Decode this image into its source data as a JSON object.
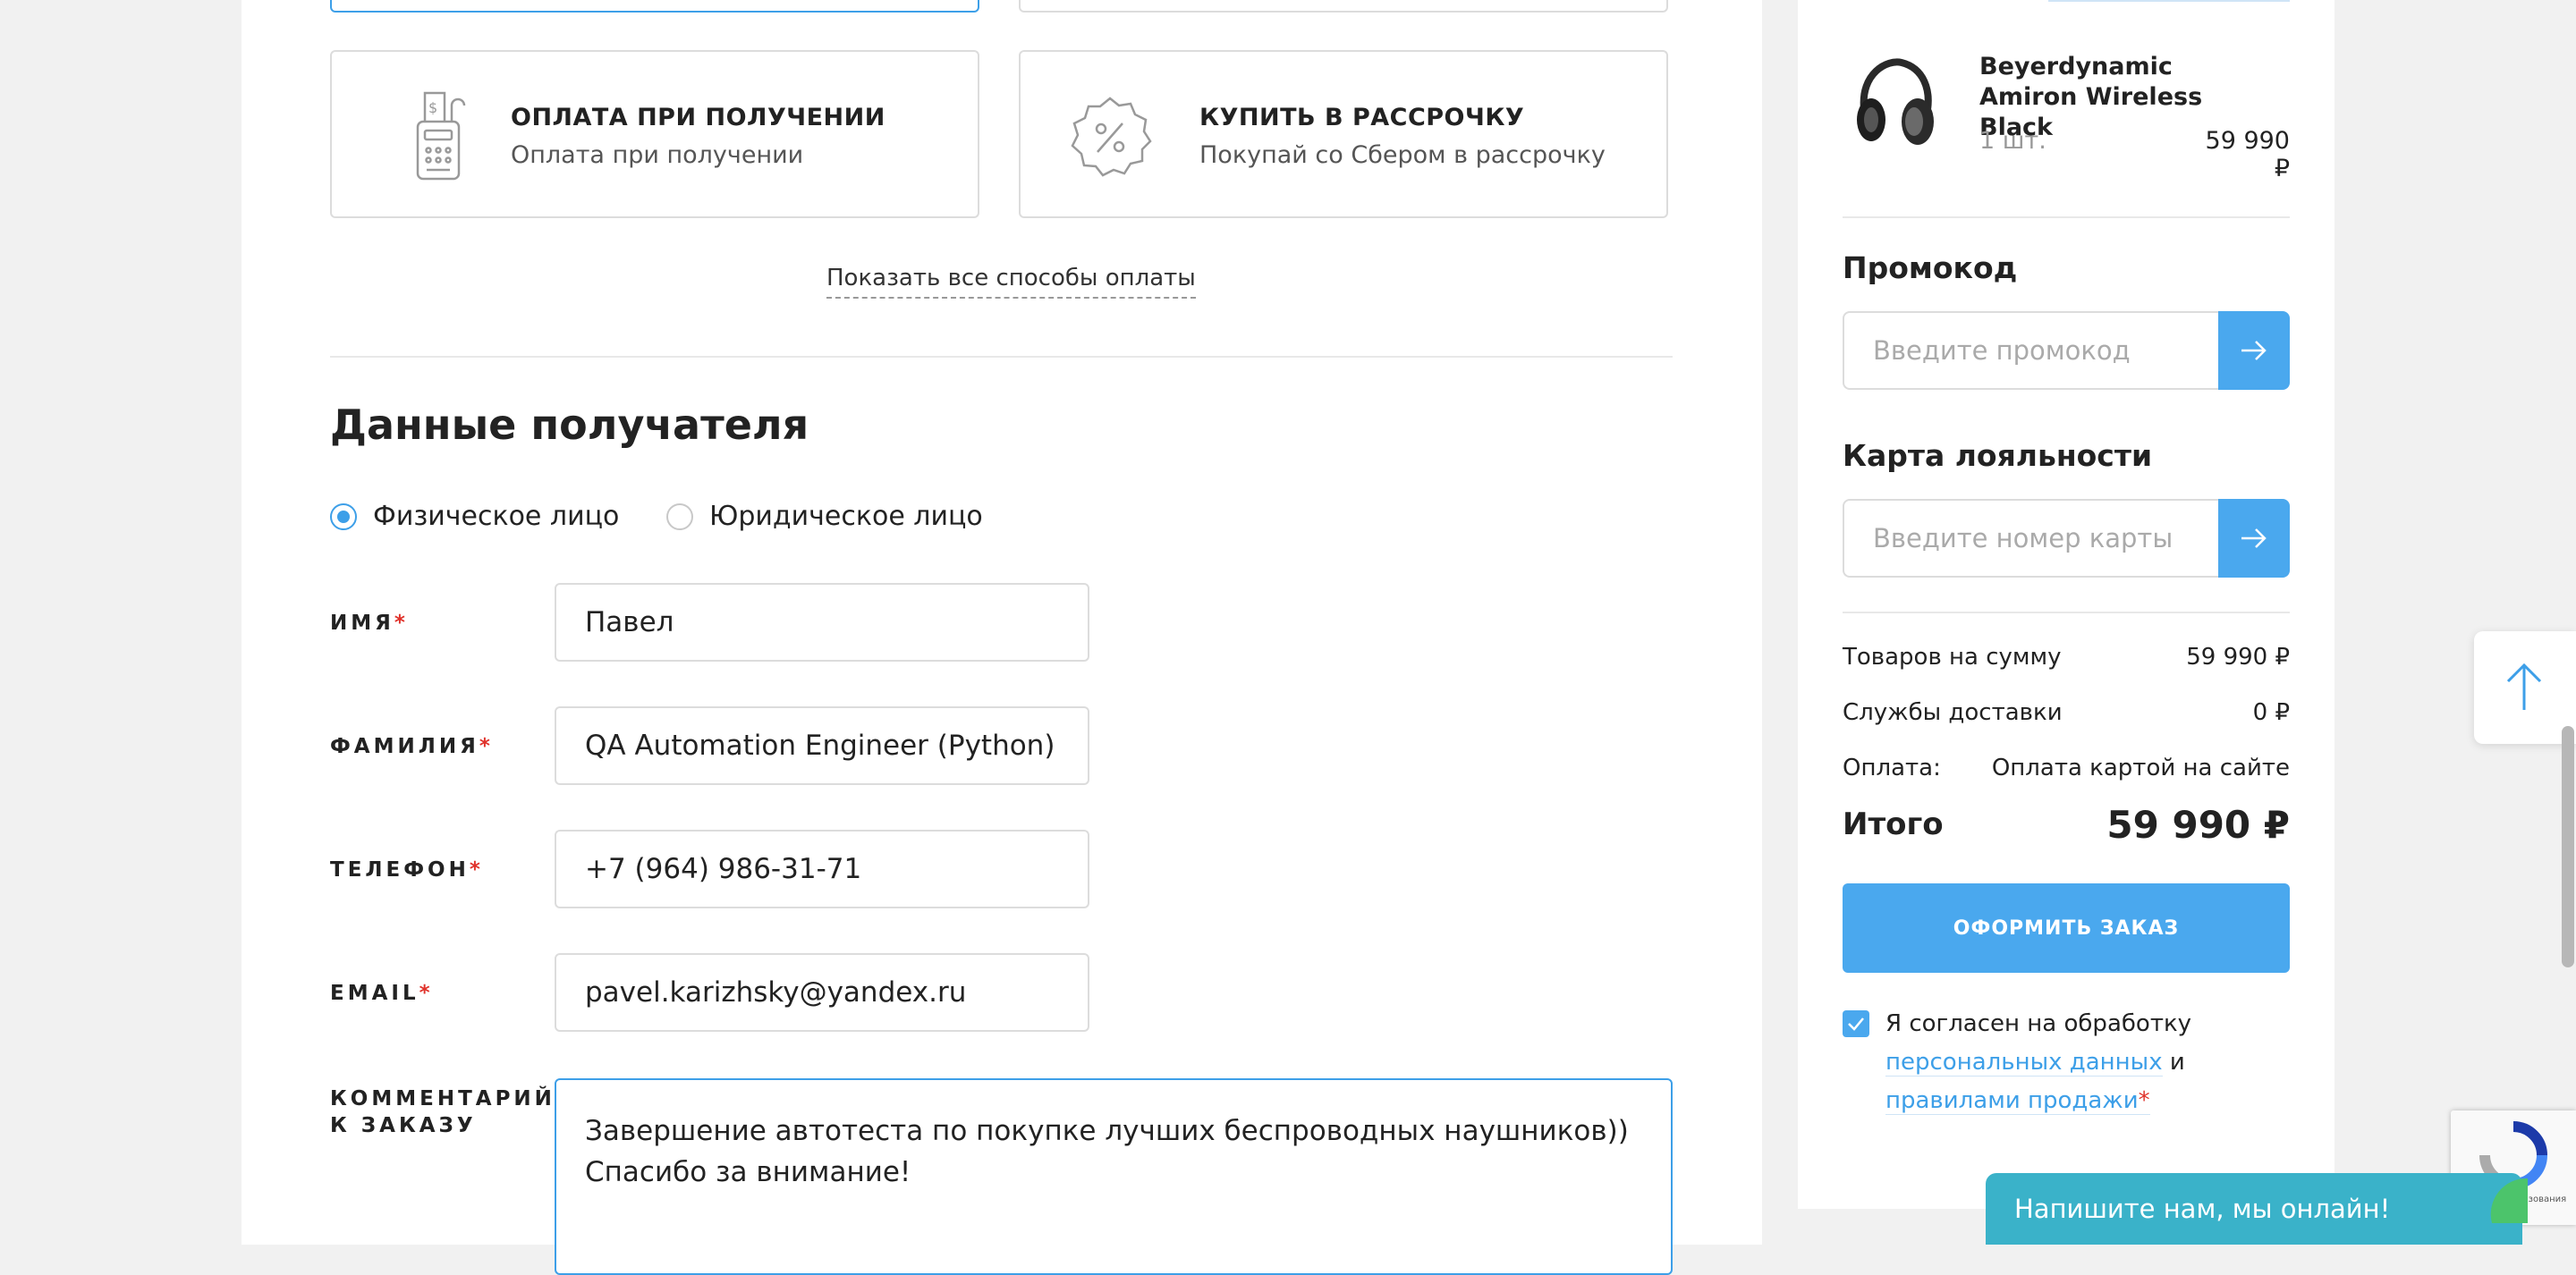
{
  "payment": {
    "cash": {
      "title": "ОПЛАТА ПРИ ПОЛУЧЕНИИ",
      "subtitle": "Оплата при получении"
    },
    "installment": {
      "title": "КУПИТЬ В РАССРОЧКУ",
      "subtitle": "Покупай со Сбером в рассрочку"
    },
    "show_all": "Показать все способы оплаты"
  },
  "recipient": {
    "title": "Данные получателя",
    "types": [
      {
        "label": "Физическое лицо",
        "checked": true
      },
      {
        "label": "Юридическое лицо",
        "checked": false
      }
    ],
    "fields": {
      "name": {
        "label": "ИМЯ",
        "value": "Павел"
      },
      "surname": {
        "label": "ФАМИЛИЯ",
        "value": "QA Automation Engineer (Python)"
      },
      "phone": {
        "label": "ТЕЛЕФОН",
        "value": "+7 (964) 986-31-71"
      },
      "email": {
        "label": "EMAIL",
        "value": "pavel.karizhsky@yandex.ru"
      },
      "comment": {
        "label_line1": "КОММЕНТАРИЙ",
        "label_line2": "К ЗАКАЗУ",
        "value": "Завершение автотеста по покупке лучших беспроводных наушников)) Спасибо за внимание!"
      }
    },
    "required_mark": "*"
  },
  "sidebar": {
    "product": {
      "name": "Beyerdynamic Amiron Wireless Black",
      "qty": "1 шт.",
      "price": "59 990 ₽"
    },
    "promo": {
      "title": "Промокод",
      "placeholder": "Введите промокод"
    },
    "loyalty": {
      "title": "Карта лояльности",
      "placeholder": "Введите номер карты"
    },
    "summary": {
      "goods_label": "Товаров на сумму",
      "goods_value": "59 990 ₽",
      "delivery_label": "Службы доставки",
      "delivery_value": "0 ₽",
      "payment_label": "Оплата:",
      "payment_value": "Оплата картой на сайте"
    },
    "total": {
      "label": "Итого",
      "value": "59 990 ₽"
    },
    "order_button": "ОФОРМИТЬ ЗАКАЗ",
    "consent": {
      "text": "Я согласен на обработку",
      "link1": "персональных данных",
      "and": "и",
      "link2": "правилами продажи",
      "req": "*"
    }
  },
  "chat": {
    "label": "Напишите нам, мы онлайн!"
  },
  "recaptcha": {
    "text": "альность - ользования"
  },
  "colors": {
    "accent": "#4aa8ee",
    "required": "#e0322b",
    "chat": "#3ab2c9"
  }
}
